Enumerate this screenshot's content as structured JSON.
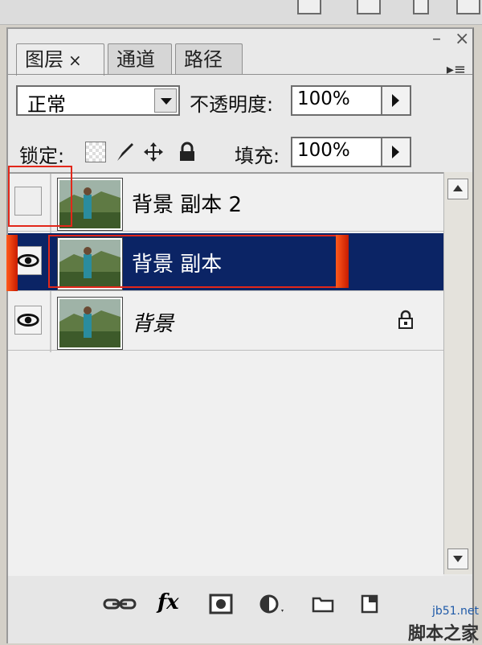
{
  "panel": {
    "tabs": [
      {
        "label": "图层",
        "close": "×",
        "active": true
      },
      {
        "label": "通道",
        "active": false
      },
      {
        "label": "路径",
        "active": false
      }
    ],
    "window_controls": {
      "minimize": "–",
      "close": "×"
    },
    "blend_mode": "正常",
    "opacity_label": "不透明度:",
    "opacity_value": "100%",
    "lock_label": "锁定:",
    "fill_label": "填充:",
    "fill_value": "100%"
  },
  "layers": [
    {
      "name": "背景 副本 2",
      "visible": false,
      "selected": false,
      "locked": false
    },
    {
      "name": "背景 副本",
      "visible": true,
      "selected": true,
      "locked": false
    },
    {
      "name": "背景",
      "visible": true,
      "selected": false,
      "locked": true
    }
  ],
  "bottom_icons": [
    "link-layers-icon",
    "fx-icon",
    "layer-mask-icon",
    "adjustment-layer-icon",
    "group-folder-icon",
    "new-layer-icon",
    "trash-icon"
  ],
  "bottom_fx_text": "fx",
  "watermark": {
    "site": "jb51.net",
    "brand": "脚本之家"
  },
  "colors": {
    "selected_row": "#0b2465",
    "highlight_red": "#e2271a"
  }
}
